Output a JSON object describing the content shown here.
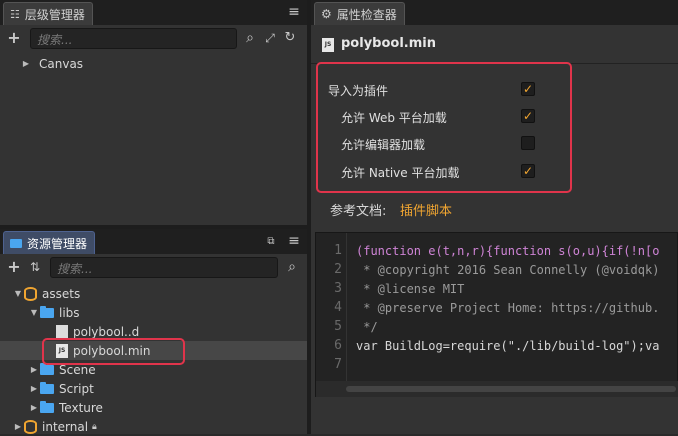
{
  "hierarchy": {
    "tab_label": "层级管理器",
    "menu_icon": "hamburger-icon",
    "search_placeholder": "搜索...",
    "tree": [
      {
        "label": "Canvas"
      }
    ]
  },
  "assets": {
    "tab_label": "资源管理器",
    "search_placeholder": "搜索...",
    "tree": [
      {
        "label": "assets"
      },
      {
        "label": "libs"
      },
      {
        "label": "polybool..d"
      },
      {
        "label": "polybool.min"
      },
      {
        "label": "Scene"
      },
      {
        "label": "Script"
      },
      {
        "label": "Texture"
      },
      {
        "label": "internal"
      }
    ]
  },
  "inspector": {
    "tab_label": "属性检查器",
    "title": "polybool.min",
    "props": [
      {
        "label": "导入为插件",
        "checked": true
      },
      {
        "label": "允许 Web 平台加载",
        "checked": true
      },
      {
        "label": "允许编辑器加载",
        "checked": false
      },
      {
        "label": "允许 Native 平台加载",
        "checked": true
      }
    ],
    "doc_label": "参考文档:",
    "doc_link": "插件脚本",
    "code_line_numbers": [
      "1",
      "2",
      "3",
      "4",
      "5",
      "6",
      "7"
    ],
    "code": [
      "(function e(t,n,r){function s(o,u){if(!n[o",
      " * @copyright 2016 Sean Connelly (@voidqk)",
      " * @license MIT",
      " * @preserve Project Home: https://github.",
      " */",
      "var BuildLog=require(\"./lib/build-log\");va",
      ""
    ]
  },
  "colors": {
    "accent": "#f0a531",
    "highlight": "#e0344b",
    "folder": "#4aa6f0"
  }
}
